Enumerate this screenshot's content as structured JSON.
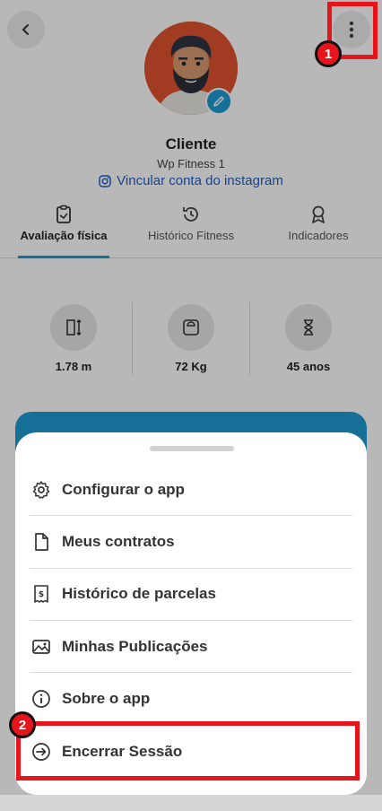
{
  "header": {
    "back_icon": "chevron-left-icon",
    "menu_icon": "kebab-menu-icon"
  },
  "profile": {
    "name": "Cliente",
    "company": "Wp Fitness 1",
    "instagram_link": "Vincular conta do instagram"
  },
  "tabs": [
    {
      "label": "Avaliação física",
      "icon": "clipboard-icon",
      "active": true
    },
    {
      "label": "Histórico Fitness",
      "icon": "history-icon",
      "active": false
    },
    {
      "label": "Indicadores",
      "icon": "award-icon",
      "active": false
    }
  ],
  "stats": [
    {
      "icon": "height-icon",
      "value": "1.78 m"
    },
    {
      "icon": "scale-icon",
      "value": "72 Kg"
    },
    {
      "icon": "hourglass-icon",
      "value": "45 anos"
    }
  ],
  "menu": {
    "items": [
      {
        "label": "Configurar o app",
        "icon": "gear-icon"
      },
      {
        "label": "Meus contratos",
        "icon": "document-icon"
      },
      {
        "label": "Histórico de parcelas",
        "icon": "receipt-icon"
      },
      {
        "label": "Minhas Publicações",
        "icon": "image-icon"
      },
      {
        "label": "Sobre o app",
        "icon": "info-icon"
      },
      {
        "label": "Encerrar Sessão",
        "icon": "logout-icon"
      }
    ]
  },
  "annotations": {
    "marker_1": "1",
    "marker_2": "2"
  },
  "colors": {
    "accent": "#1f9ad0",
    "highlight": "#e8141c",
    "link": "#1f5fc9"
  }
}
